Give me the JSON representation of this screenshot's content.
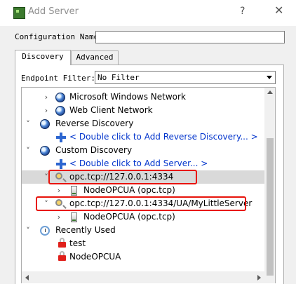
{
  "window": {
    "title": "Add Server",
    "help_label": "?",
    "close_label": "✕"
  },
  "config": {
    "label": "Configuration Name",
    "value": ""
  },
  "tabs": [
    {
      "label": "Discovery",
      "active": true
    },
    {
      "label": "Advanced",
      "active": false
    }
  ],
  "endpoint_filter": {
    "label": "Endpoint Filter:",
    "selected": "No Filter"
  },
  "tree": {
    "rows": [
      {
        "label": "Microsoft Windows Network",
        "expander": "›",
        "icon": "globe-icon"
      },
      {
        "label": "Web Client Network",
        "expander": "›",
        "icon": "globe-icon"
      },
      {
        "label": "Reverse Discovery",
        "expander": "˅",
        "icon": "globe-icon"
      },
      {
        "label": "< Double click to Add Reverse Discovery... >",
        "icon": "plus-icon"
      },
      {
        "label": "Custom Discovery",
        "expander": "˅",
        "icon": "globe-icon"
      },
      {
        "label": "< Double click to Add Server... >",
        "icon": "plus-icon"
      },
      {
        "label": "opc.tcp://127.0.0.1:4334",
        "expander": "˅",
        "icon": "magnifier-icon",
        "selected": true,
        "highlighted": true
      },
      {
        "label": "NodeOPCUA (opc.tcp)",
        "expander": "›",
        "icon": "server-icon"
      },
      {
        "label": "opc.tcp://127.0.0.1:4334/UA/MyLittleServer",
        "expander": "˅",
        "icon": "magnifier-icon",
        "highlighted": true
      },
      {
        "label": "NodeOPCUA (opc.tcp)",
        "expander": "›",
        "icon": "server-icon"
      },
      {
        "label": "Recently Used",
        "expander": "˅",
        "icon": "clock-icon"
      },
      {
        "label": "test",
        "icon": "lock-icon"
      },
      {
        "label": "NodeOPCUA",
        "icon": "lock-icon"
      }
    ]
  },
  "colors": {
    "highlight_box": "#e8130b",
    "link_text": "#0033cc",
    "selection": "#d9d9d9"
  }
}
